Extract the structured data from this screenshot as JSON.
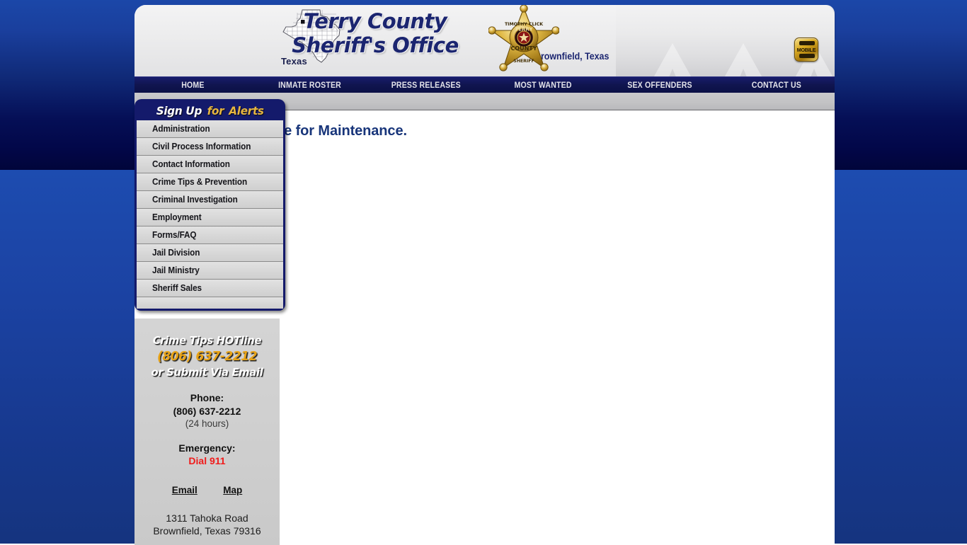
{
  "header": {
    "map_label": "Texas",
    "map_icon": "texas-county-map-icon",
    "title_line1": "Terry County",
    "title_line2": "Sheriff's Office",
    "subtitle": "Brownfield, Texas",
    "badge_icon": "sheriff-star-badge-icon",
    "badge_text_top": "TIMOTHY CLICK",
    "badge_text_mid": "TERRY",
    "badge_text_low": "COUNTY",
    "badge_text_bottom": "SHERIFF",
    "mobile_label": "MOBILE"
  },
  "nav": {
    "items": [
      {
        "label": "HOME"
      },
      {
        "label": "INMATE ROSTER"
      },
      {
        "label": "PRESS RELEASES"
      },
      {
        "label": "MOST WANTED"
      },
      {
        "label": "SEX OFFENDERS"
      },
      {
        "label": "CONTACT US"
      }
    ]
  },
  "sidebar": {
    "alerts_title_part1": "Sign Up",
    "alerts_title_part2": "for",
    "alerts_title_part3": "Alerts",
    "items": [
      {
        "label": "Administration"
      },
      {
        "label": "Civil Process Information"
      },
      {
        "label": "Contact Information"
      },
      {
        "label": "Crime Tips & Prevention"
      },
      {
        "label": "Criminal Investigation"
      },
      {
        "label": "Employment"
      },
      {
        "label": "Forms/FAQ"
      },
      {
        "label": "Jail Division"
      },
      {
        "label": "Jail Ministry"
      },
      {
        "label": "Sheriff Sales"
      }
    ],
    "contact": {
      "hotline_line1": "Crime Tips HOTline",
      "hotline_number": "(806) 637-2212",
      "hotline_line3": "or Submit Via Email",
      "phone_label": "Phone:",
      "phone_number": "(806) 637-2212",
      "phone_note": "(24 hours)",
      "emergency_label": "Emergency:",
      "emergency_value": "Dial 911",
      "link_email": "Email",
      "link_map": "Map",
      "address_line1": "1311 Tahoka Road",
      "address_line2": "Brownfield, Texas 79316"
    }
  },
  "main": {
    "heading": "Inmate Roster Offline for Maintenance."
  },
  "colors": {
    "brand_navy": "#141a6b",
    "heading_blue": "#18357a",
    "gold": "#e8a317",
    "alert_red": "#f01b1b",
    "page_blue": "#1b42a2"
  }
}
